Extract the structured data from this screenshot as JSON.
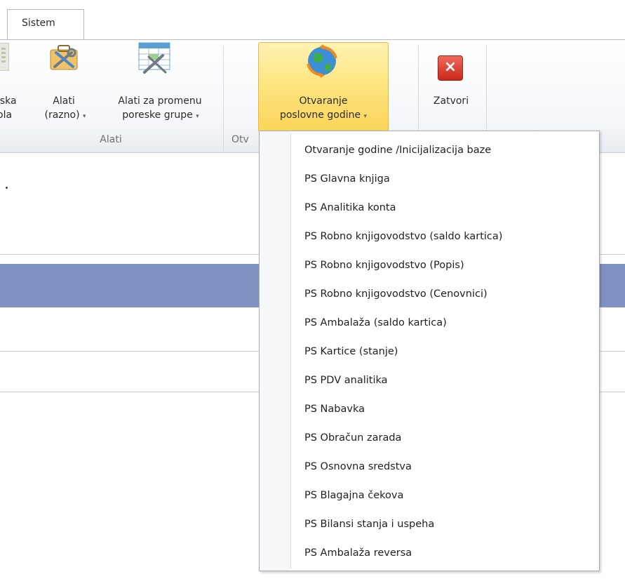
{
  "tabs": [
    {
      "label": "Sistem",
      "active": true
    }
  ],
  "ribbon": {
    "partial_button": {
      "line1": "iska",
      "line2": "ola"
    },
    "tools_button": {
      "line1": "Alati",
      "line2": "(razno)",
      "dropdown_glyph": "▾",
      "icon": "tools-icon"
    },
    "tax_group_button": {
      "line1": "Alati za promenu",
      "line2": "poreske grupe",
      "dropdown_glyph": "▾",
      "icon": "grid-tools-icon"
    },
    "group_alati_caption": "Alati",
    "open_year_button": {
      "line1": "Otvaranje",
      "line2": "poslovne godine",
      "dropdown_glyph": "▾",
      "icon": "globe-refresh-icon",
      "state": "pressed"
    },
    "group_otv_caption": "Otv",
    "close_button": {
      "label": "Zatvori",
      "glyph": "×",
      "icon": "close-icon"
    }
  },
  "dropdown_menu": {
    "items": [
      "Otvaranje godine /Inicijalizacija baze",
      "PS Glavna knjiga",
      "PS Analitika konta",
      "PS Robno knjigovodstvo (saldo kartica)",
      "PS Robno knjigovodstvo (Popis)",
      "PS Robno knjigovodstvo (Cenovnici)",
      "PS Ambalaža (saldo kartica)",
      "PS Kartice (stanje)",
      "PS PDV analitika",
      "PS Nabavka",
      "PS Obračun zarada",
      "PS Osnovna sredstva",
      "PS Blagajna čekova",
      "PS Bilansi stanja i uspeha",
      "PS Ambalaža reversa"
    ]
  },
  "colors": {
    "selected_row": "#7f92c2",
    "pressed_button": "#fde580",
    "close_icon": "#c9281a"
  }
}
